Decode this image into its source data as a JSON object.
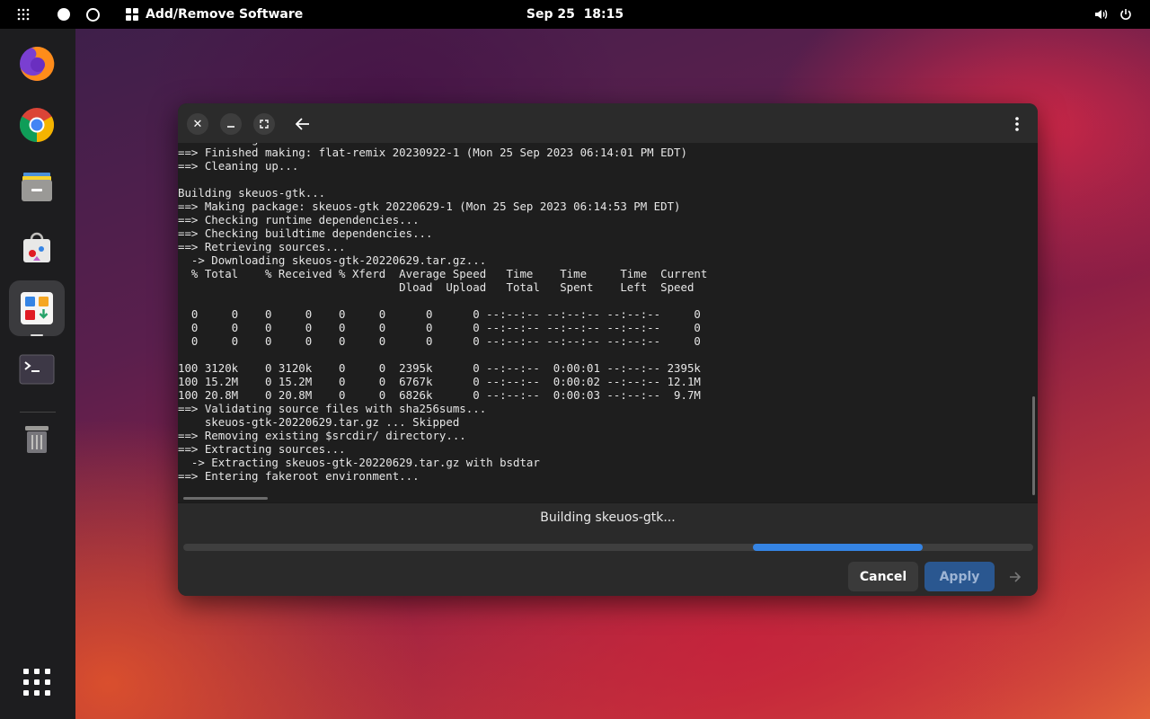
{
  "topbar": {
    "app_name": "Add/Remove Software",
    "clock": "Sep 25  18:15"
  },
  "dock": {
    "items": [
      {
        "name": "Firefox",
        "icon": "firefox-icon"
      },
      {
        "name": "Chrome",
        "icon": "chrome-icon"
      },
      {
        "name": "Files",
        "icon": "files-icon"
      },
      {
        "name": "Software",
        "icon": "software-store-icon"
      },
      {
        "name": "Add/Remove Software",
        "icon": "add-remove-software-icon",
        "active": true
      },
      {
        "name": "Terminal",
        "icon": "terminal-icon"
      },
      {
        "name": "Trash",
        "icon": "trash-icon"
      }
    ]
  },
  "window": {
    "terminal_lines": [
      "  -> Leaving fakeroot environment.",
      "==> Finished making: flat-remix 20230922-1 (Mon 25 Sep 2023 06:14:01 PM EDT)",
      "==> Cleaning up...",
      "",
      "Building skeuos-gtk...",
      "==> Making package: skeuos-gtk 20220629-1 (Mon 25 Sep 2023 06:14:53 PM EDT)",
      "==> Checking runtime dependencies...",
      "==> Checking buildtime dependencies...",
      "==> Retrieving sources...",
      "  -> Downloading skeuos-gtk-20220629.tar.gz...",
      "  % Total    % Received % Xferd  Average Speed   Time    Time     Time  Current",
      "                                 Dload  Upload   Total   Spent    Left  Speed",
      "",
      "  0     0    0     0    0     0      0      0 --:--:-- --:--:-- --:--:--     0",
      "  0     0    0     0    0     0      0      0 --:--:-- --:--:-- --:--:--     0",
      "  0     0    0     0    0     0      0      0 --:--:-- --:--:-- --:--:--     0",
      "",
      "100 3120k    0 3120k    0     0  2395k      0 --:--:--  0:00:01 --:--:-- 2395k",
      "100 15.2M    0 15.2M    0     0  6767k      0 --:--:--  0:00:02 --:--:-- 12.1M",
      "100 20.8M    0 20.8M    0     0  6826k      0 --:--:--  0:00:03 --:--:--  9.7M",
      "==> Validating source files with sha256sums...",
      "    skeuos-gtk-20220629.tar.gz ... Skipped",
      "==> Removing existing $srcdir/ directory...",
      "==> Extracting sources...",
      "  -> Extracting skeuos-gtk-20220629.tar.gz with bsdtar",
      "==> Entering fakeroot environment..."
    ],
    "status_text": "Building skeuos-gtk...",
    "progress": {
      "start_fraction": 0.67,
      "fill_fraction": 0.2
    },
    "cancel_label": "Cancel",
    "apply_label": "Apply"
  },
  "colors": {
    "accent": "#3584e4",
    "apply_bg": "#2a5790"
  }
}
